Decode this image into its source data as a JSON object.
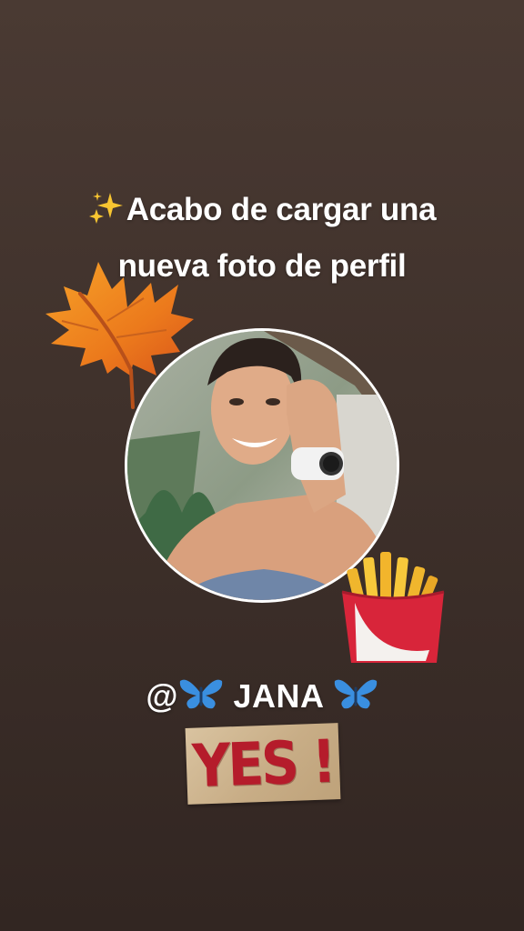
{
  "story": {
    "headline_line1": "Acabo de cargar una",
    "headline_line2": "nueva foto de perfil",
    "mention_handle": "@",
    "mention_name": "JANA",
    "sticker_text": "YES !"
  },
  "stickers": {
    "sparkle": "sparkles-icon",
    "leaf": "maple-leaf-icon",
    "fries": "french-fries-icon",
    "butterfly": "butterfly-icon"
  },
  "colors": {
    "background": "#3f312b",
    "avatar_ring": "#ffffff",
    "sticker_red": "#b51c2b"
  }
}
